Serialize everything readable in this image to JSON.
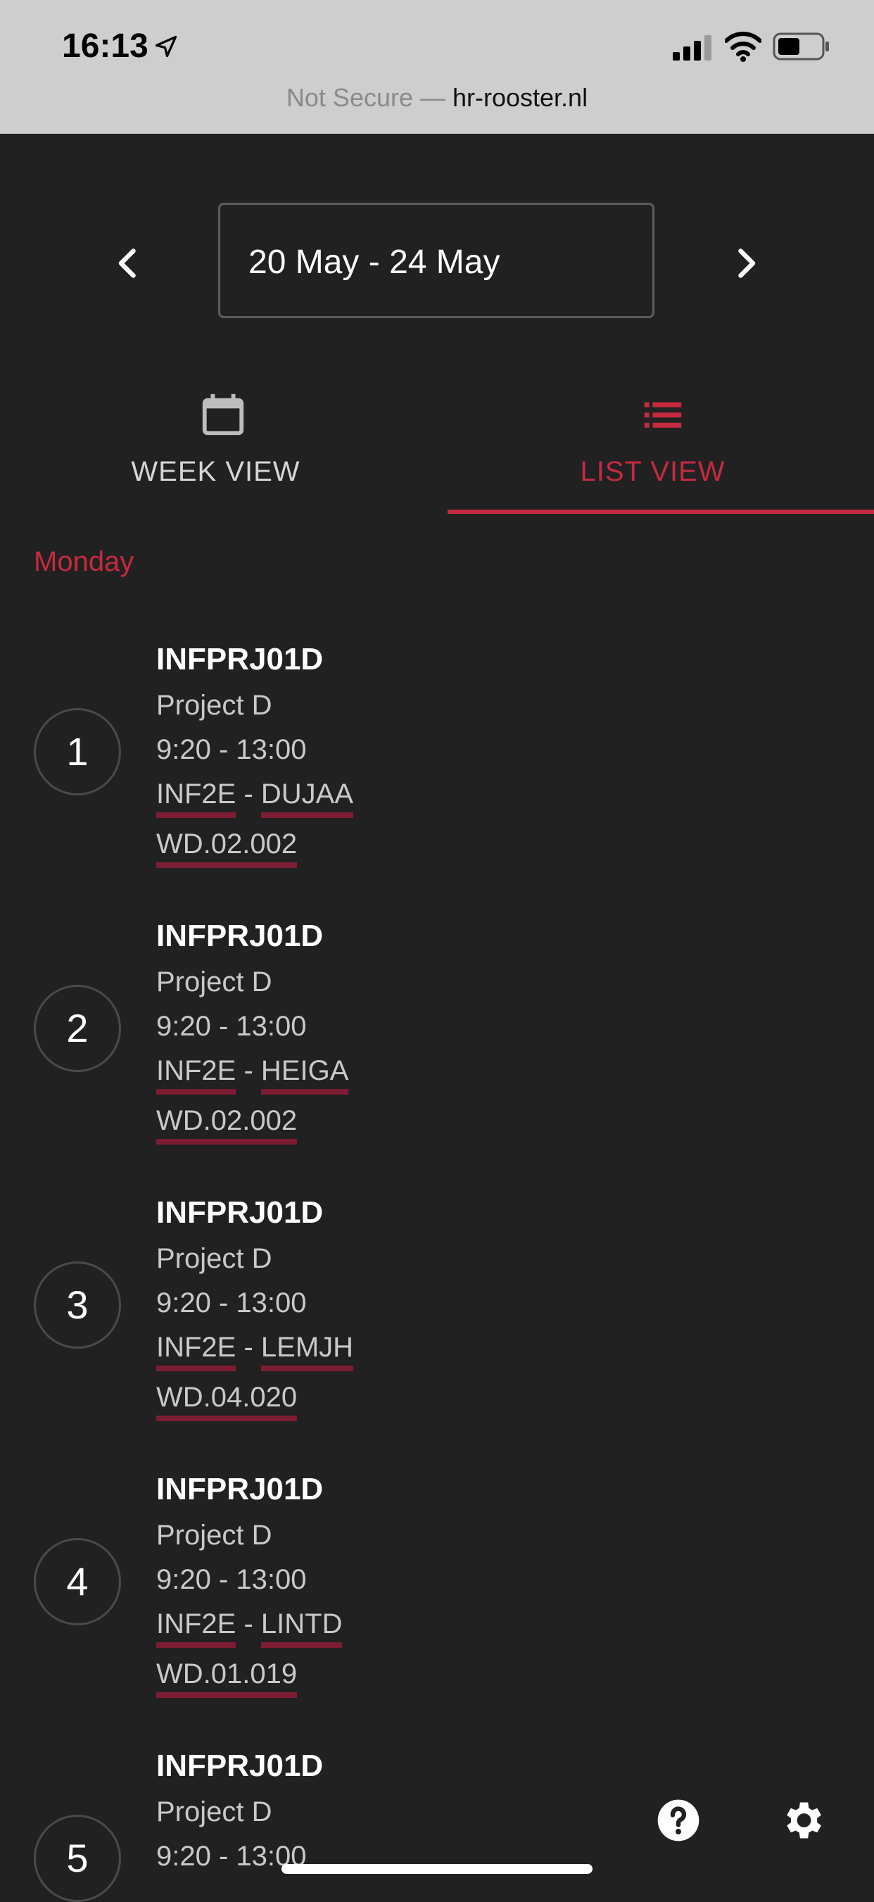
{
  "status_bar": {
    "time": "16:13",
    "icons": [
      "location-arrow-icon",
      "signal-icon",
      "wifi-icon",
      "battery-icon"
    ]
  },
  "url_bar": {
    "prefix": "Not Secure — ",
    "host": "hr-rooster.nl"
  },
  "date_nav": {
    "range": "20 May - 24 May",
    "prev_icon": "chevron-left-icon",
    "next_icon": "chevron-right-icon"
  },
  "tabs": [
    {
      "label": "WEEK VIEW",
      "icon": "calendar-icon",
      "active": false
    },
    {
      "label": "LIST VIEW",
      "icon": "list-icon",
      "active": true
    }
  ],
  "colors": {
    "accent": "#c62a3f",
    "link_underline": "#7d1d33",
    "background": "#212121"
  },
  "day": {
    "heading": "Monday",
    "lessons": [
      {
        "number": "1",
        "code": "INFPRJ01D",
        "title": "Project D",
        "time": "9:20 - 13:00",
        "class": "INF2E",
        "separator": " - ",
        "teacher": "DUJAA",
        "room": "WD.02.002"
      },
      {
        "number": "2",
        "code": "INFPRJ01D",
        "title": "Project D",
        "time": "9:20 - 13:00",
        "class": "INF2E",
        "separator": " - ",
        "teacher": "HEIGA",
        "room": "WD.02.002"
      },
      {
        "number": "3",
        "code": "INFPRJ01D",
        "title": "Project D",
        "time": "9:20 - 13:00",
        "class": "INF2E",
        "separator": " - ",
        "teacher": "LEMJH",
        "room": "WD.04.020"
      },
      {
        "number": "4",
        "code": "INFPRJ01D",
        "title": "Project D",
        "time": "9:20 - 13:00",
        "class": "INF2E",
        "separator": " - ",
        "teacher": "LINTD",
        "room": "WD.01.019"
      },
      {
        "number": "5",
        "code": "INFPRJ01D",
        "title": "Project D",
        "time": "9:20 - 13:00",
        "class": "",
        "separator": "",
        "teacher": "",
        "room": ""
      }
    ]
  },
  "footer": {
    "help_icon": "help-icon",
    "settings_icon": "gear-icon"
  }
}
